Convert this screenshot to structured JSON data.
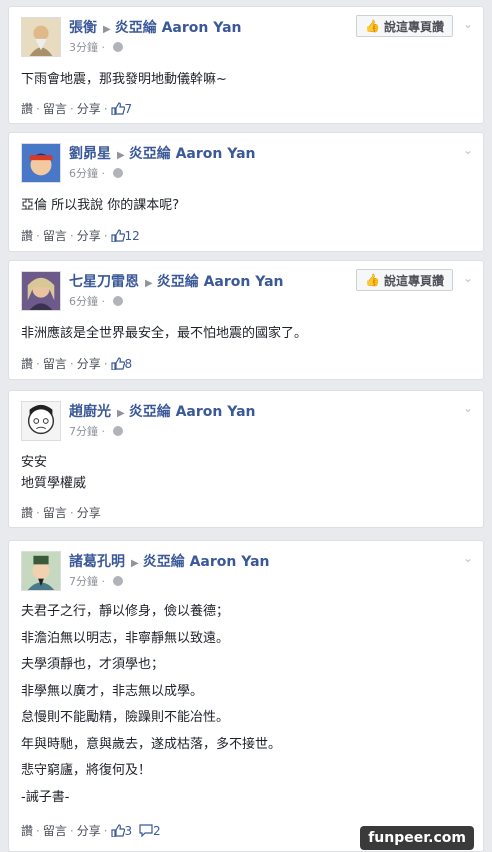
{
  "actions": {
    "like": "讚",
    "comment": "留言",
    "share": "分享",
    "separator": "·"
  },
  "like_page_label": "說這專頁讚",
  "watermark": "funpeer.com",
  "posts": [
    {
      "author": "張衡",
      "page": "炎亞綸 Aaron Yan",
      "time": "3分鐘",
      "text": [
        "下雨會地震，那我發明地動儀幹嘛~"
      ],
      "likes": "7"
    },
    {
      "author": "劉昴星",
      "page": "炎亞綸 Aaron Yan",
      "time": "6分鐘",
      "text": [
        "亞倫 所以我說 你的課本呢?"
      ],
      "likes": "12"
    },
    {
      "author": "七星刀雷恩",
      "page": "炎亞綸 Aaron Yan",
      "time": "6分鐘",
      "text": [
        "非洲應該是全世界最安全，最不怕地震的國家了。"
      ],
      "likes": "8"
    },
    {
      "author": "趙廚光",
      "page": "炎亞綸 Aaron Yan",
      "time": "7分鐘",
      "text": [
        "安安",
        "地質學權威"
      ]
    },
    {
      "author": "諸葛孔明",
      "page": "炎亞綸 Aaron Yan",
      "time": "7分鐘",
      "text": [
        "夫君子之行，靜以修身，儉以養德；",
        "非澹泊無以明志，非寧靜無以致遠。",
        "夫學須靜也，才須學也；",
        "非學無以廣才，非志無以成學。",
        "怠慢則不能勵精，險躁則不能冶性。",
        "年與時馳，意與歲去，遂成枯落，多不接世。",
        "悲守窮廬，將復何及！",
        "-誡子書-"
      ],
      "likes": "3",
      "comments": "2"
    }
  ]
}
